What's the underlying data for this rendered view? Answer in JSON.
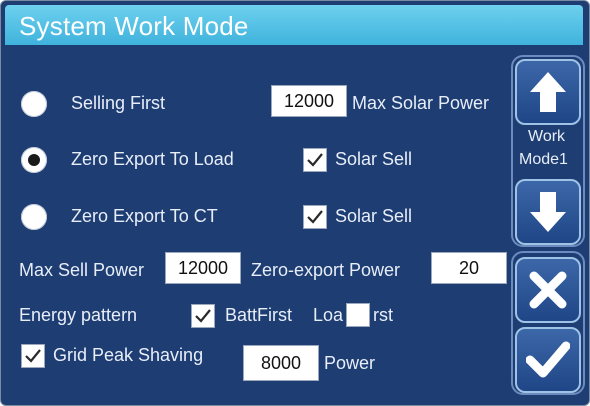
{
  "title": "System Work Mode",
  "modes": [
    {
      "label": "Selling First",
      "selected": false
    },
    {
      "label": "Zero Export To Load",
      "selected": true
    },
    {
      "label": "Zero Export To CT",
      "selected": false
    }
  ],
  "max_solar_power": {
    "value": "12000",
    "label": "Max Solar Power"
  },
  "solar_sell_load": {
    "label": "Solar Sell",
    "checked": true
  },
  "solar_sell_ct": {
    "label": "Solar Sell",
    "checked": true
  },
  "max_sell_power": {
    "label": "Max Sell Power",
    "value": "12000"
  },
  "zero_export_power": {
    "label": "Zero-export Power",
    "value": "20"
  },
  "energy_pattern": {
    "label": "Energy pattern",
    "batt_first": {
      "label": "BattFirst",
      "checked": true
    },
    "load_first": {
      "label_pre": "Loa",
      "label_post": "rst",
      "checked": false
    }
  },
  "grid_peak_shaving": {
    "label": "Grid Peak Shaving",
    "checked": true,
    "value": "8000",
    "unit": "Power"
  },
  "side": {
    "work_mode_label_1": "Work",
    "work_mode_label_2": "Mode1"
  },
  "colors": {
    "background": "#1e3d73",
    "title_bar": "#46b8e0",
    "button": "#2a5597"
  },
  "icons": {
    "up": "arrow-up-icon",
    "down": "arrow-down-icon",
    "cancel": "close-icon",
    "confirm": "checkmark-icon"
  }
}
